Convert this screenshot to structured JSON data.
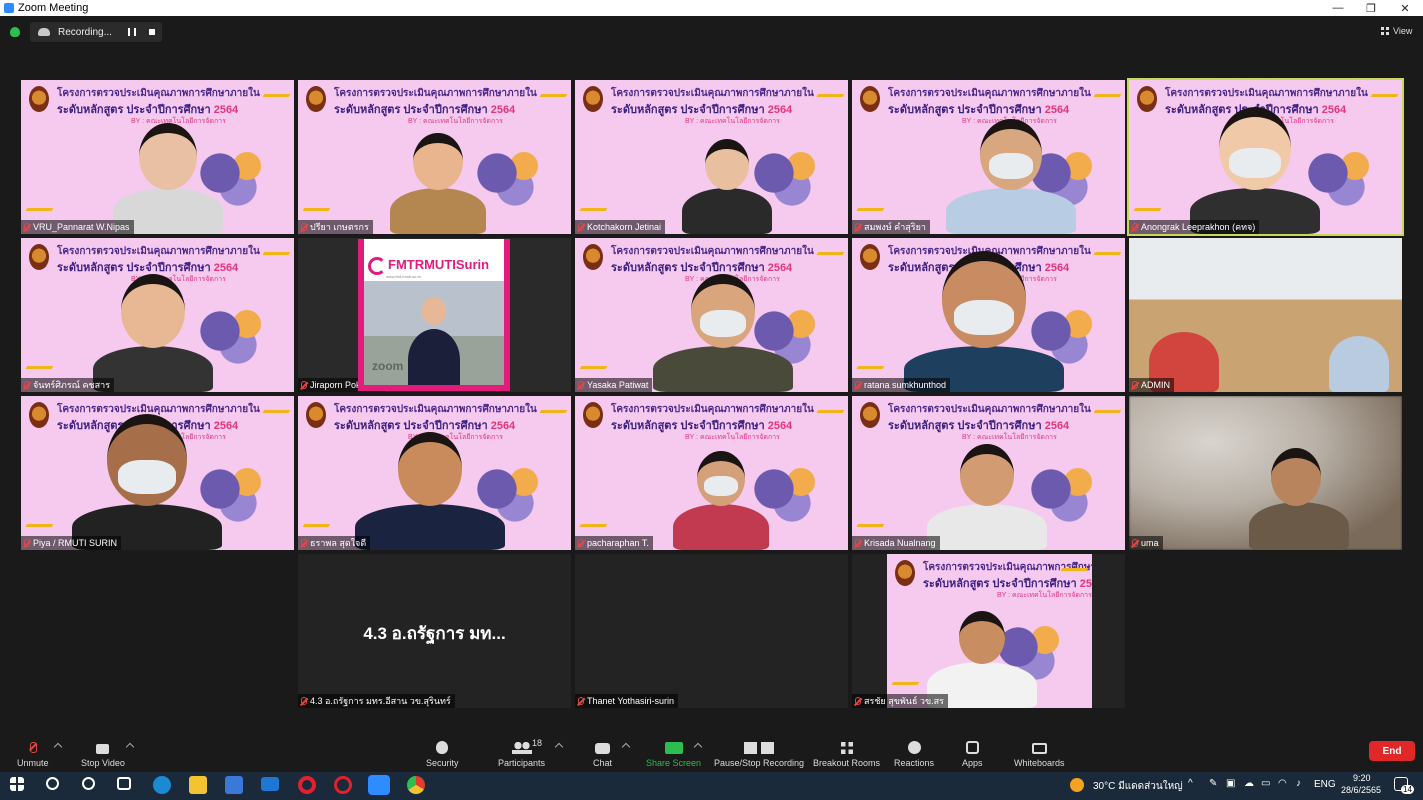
{
  "window": {
    "title": "Zoom Meeting"
  },
  "recording": {
    "label": "Recording..."
  },
  "view": {
    "label": "View"
  },
  "slide": {
    "line1": "โครงการตรวจประเมินคุณภาพการศึกษาภายใน",
    "line2": "ระดับหลักสูตร ประจำปีการศึกษา",
    "year": "2564",
    "line3": "BY : คณะเทคโนโลยีการจัดการ"
  },
  "fmt": {
    "title": "FMTRMUTISurin",
    "sub": "www.fmt.rmuti.ac.th",
    "zoom_text": "zoom"
  },
  "participants": [
    {
      "name": "VRU_Pannarat W.Nipas"
    },
    {
      "name": "ปรียา เกษตรกร"
    },
    {
      "name": "Kotchakorn Jetinai"
    },
    {
      "name": "สมพงษ์ คำสุริยา"
    },
    {
      "name": "Anongrak Leeprakhon (คทจ)"
    },
    {
      "name": "จันทร์ศิภรณ์ คชสาร"
    },
    {
      "name": "Jiraporn Pokpoon"
    },
    {
      "name": "Yasaka Patiwat"
    },
    {
      "name": "ratana sumkhunthod"
    },
    {
      "name": "ADMIN"
    },
    {
      "name": "Piya / RMUTI SURIN"
    },
    {
      "name": "ธราพล สุดใจดี"
    },
    {
      "name": "pacharaphan T."
    },
    {
      "name": "Krisada Nualnang"
    },
    {
      "name": "uma"
    },
    {
      "name": "4.3 อ.ถรัฐการ มทร.อีสาน วข.สุรินทร์",
      "big": "4.3 อ.ถรัฐการ มท..."
    },
    {
      "name": "Thanet Yothasiri-surin"
    },
    {
      "name": "สรชัย สุขพันธ์ วข.สร"
    }
  ],
  "toolbar": {
    "unmute": "Unmute",
    "stop_video": "Stop Video",
    "security": "Security",
    "participants": "Participants",
    "participants_count": "18",
    "chat": "Chat",
    "share_screen": "Share Screen",
    "pause_stop_recording": "Pause/Stop Recording",
    "breakout_rooms": "Breakout Rooms",
    "reactions": "Reactions",
    "apps": "Apps",
    "whiteboards": "Whiteboards",
    "end": "End"
  },
  "taskbar": {
    "weather": "30°C มีแดดส่วนใหญ่",
    "lang": "ENG",
    "time": "9:20",
    "date": "28/6/2565",
    "notifications": "14"
  },
  "colors": {
    "accent": "#2d8cff",
    "end": "#e02828",
    "share": "#2dbe4f",
    "active_border": "#c9d85a",
    "slide_pink": "#f6c9ef"
  }
}
